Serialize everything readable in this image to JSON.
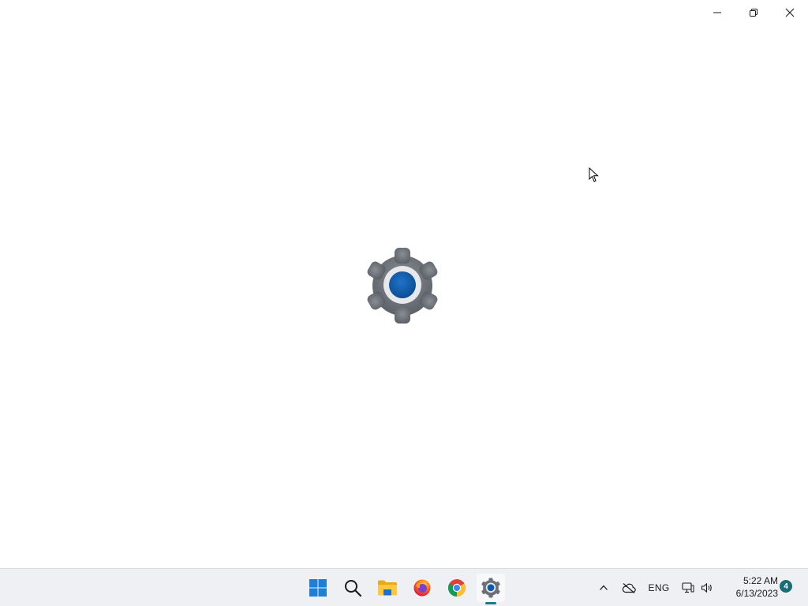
{
  "window": {
    "controls": {
      "minimize_icon": "minimize-icon",
      "restore_icon": "restore-icon",
      "close_icon": "close-icon"
    },
    "splash_icon": "settings-gear-icon"
  },
  "taskbar": {
    "pinned": [
      {
        "name": "start",
        "icon": "windows-logo-icon"
      },
      {
        "name": "search",
        "icon": "search-icon"
      },
      {
        "name": "file-explorer",
        "icon": "folder-icon"
      },
      {
        "name": "firefox",
        "icon": "firefox-icon"
      },
      {
        "name": "chrome",
        "icon": "chrome-icon"
      },
      {
        "name": "settings",
        "icon": "settings-gear-icon",
        "active": true
      }
    ],
    "tray": {
      "language": "ENG",
      "time": "5:22 AM",
      "date": "6/13/2023",
      "notification_count": "4"
    }
  },
  "colors": {
    "taskbar_bg": "#eef0f4",
    "active_indicator": "#1a7a88",
    "gear_grey": "#6b7077",
    "gear_blue": "#0f5aa8",
    "windows_blue": "#1e7fd6"
  }
}
